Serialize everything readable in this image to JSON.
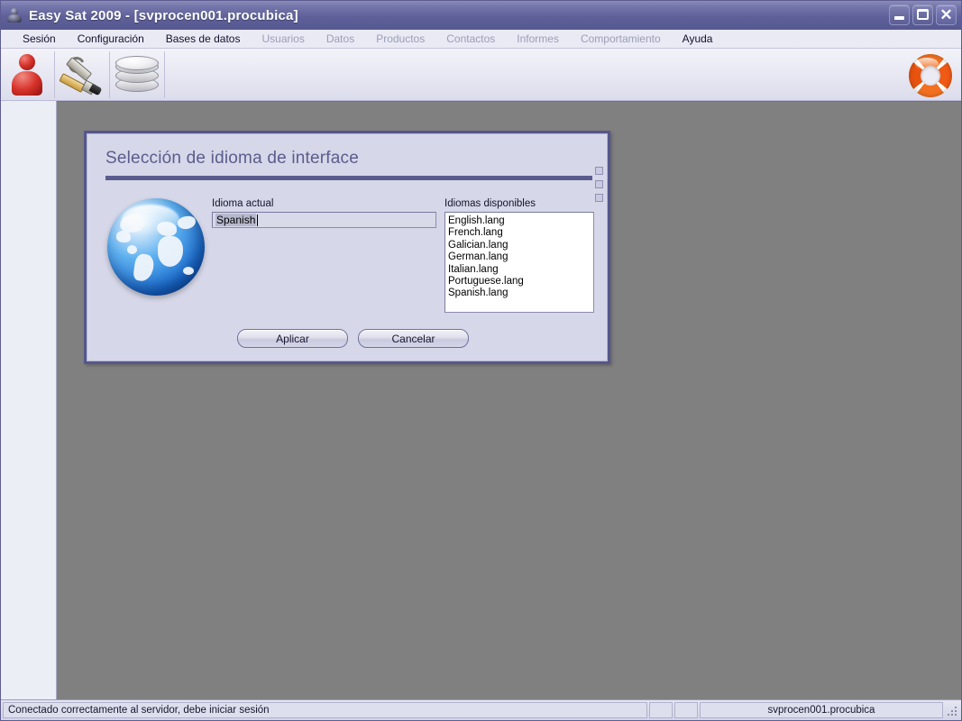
{
  "window": {
    "title": "Easy Sat 2009 - [svprocen001.procubica]",
    "app_icon": "app-icon",
    "controls": {
      "minimize": "minimize-button",
      "maximize": "maximize-button",
      "close": "close-button",
      "close_glyph": "✕"
    }
  },
  "menubar": {
    "items": [
      {
        "label": "Sesión",
        "enabled": true
      },
      {
        "label": "Configuración",
        "enabled": true
      },
      {
        "label": "Bases de datos",
        "enabled": true
      },
      {
        "label": "Usuarios",
        "enabled": false
      },
      {
        "label": "Datos",
        "enabled": false
      },
      {
        "label": "Productos",
        "enabled": false
      },
      {
        "label": "Contactos",
        "enabled": false
      },
      {
        "label": "Informes",
        "enabled": false
      },
      {
        "label": "Comportamiento",
        "enabled": false
      },
      {
        "label": "Ayuda",
        "enabled": true
      }
    ]
  },
  "toolbar": {
    "buttons": [
      {
        "name": "user-icon"
      },
      {
        "name": "tools-icon"
      },
      {
        "name": "database-icon"
      }
    ],
    "help": {
      "name": "life-ring-icon"
    }
  },
  "dialog": {
    "title": "Selección de idioma de interface",
    "globe_icon": "globe-icon",
    "current_language": {
      "label": "Idioma actual",
      "value": "Spanish"
    },
    "available_languages": {
      "label": "Idiomas disponibles",
      "items": [
        "English.lang",
        "French.lang",
        "Galician.lang",
        "German.lang",
        "Italian.lang",
        "Portuguese.lang",
        "Spanish.lang"
      ]
    },
    "buttons": {
      "apply": "Aplicar",
      "cancel": "Cancelar"
    }
  },
  "statusbar": {
    "message": "Conectado correctamente al servidor, debe iniciar sesión",
    "pane_2": "",
    "pane_3": "",
    "server": "svprocen001.procubica"
  },
  "colors": {
    "title_bar": "#5f6099",
    "frame": "#55568c",
    "dialog_accent": "#5b5c8d",
    "mdi_background": "#808080",
    "panel": "#d6d7e8"
  }
}
